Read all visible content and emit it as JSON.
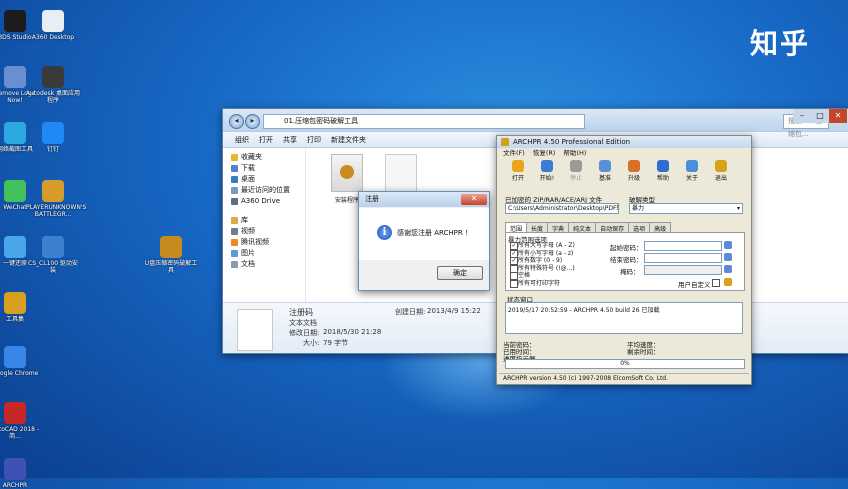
{
  "watermark": "知乎",
  "desktop_icons": [
    {
      "label": "3DS Studio",
      "color": "#1c1c1c"
    },
    {
      "label": "A360 Desktop",
      "color": "#e9eef5"
    },
    {
      "label": "Remove Logo Now!",
      "color": "#6a8fd0"
    },
    {
      "label": "Autodesk 桌面应用程序",
      "color": "#3a3a3a"
    },
    {
      "label": "网络截图工具",
      "color": "#2da8e0"
    },
    {
      "label": "钉钉",
      "color": "#1f8af5"
    },
    {
      "label": "WeChat",
      "color": "#43c15b"
    },
    {
      "label": "PLAYERUNKNOWN'S BATTLEGR...",
      "color": "#d69b2a"
    },
    {
      "label": "一键还原",
      "color": "#49a6e9"
    },
    {
      "label": "CS_CL100 驱动安装",
      "color": "#3d7fd1"
    },
    {
      "label": "U盘压缩密码破解工具",
      "color": "#c78a1e"
    },
    {
      "label": "工具集",
      "color": "#d7a020"
    },
    {
      "label": "Google Chrome",
      "color": "#3a86e8"
    },
    {
      "label": "AutoCAD 2018 - 简...",
      "color": "#c62828"
    },
    {
      "label": "ARCHPR",
      "color": "#3f51b5"
    }
  ],
  "explorer": {
    "address": "01.压缩包密码破解工具",
    "search_placeholder": "搜索 01.压缩包...",
    "toolbar": [
      "组织",
      "打开",
      "共享",
      "打印",
      "新建文件夹"
    ],
    "nav": {
      "favorites": "收藏夹",
      "favorites_items": [
        "下载",
        "桌面",
        "最近访问的位置",
        "A360 Drive"
      ],
      "library": "库",
      "library_items": [
        "视频",
        "腾讯视频",
        "图片",
        "文档"
      ]
    },
    "files": [
      {
        "name": "安装程序"
      },
      {
        "name": ""
      }
    ],
    "details": {
      "filename": "注册码",
      "type": "文本文档",
      "created_label": "创建日期:",
      "created": "2013/4/9 15:22",
      "modified_label": "修改日期:",
      "modified": "2018/5/30 21:28",
      "size_label": "大小:",
      "size": "79 字节"
    }
  },
  "dialog": {
    "title": "注册",
    "message": "感谢您注册 ARCHPR ！",
    "ok": "确定"
  },
  "archpr": {
    "title": "ARCHPR 4.50 Professional Edition",
    "menu": [
      "文件(F)",
      "恢复(R)",
      "帮助(H)"
    ],
    "toolbar": [
      {
        "label": "打开",
        "color": "#e7a51c",
        "enabled": true
      },
      {
        "label": "开始!",
        "color": "#3b7bd4",
        "enabled": true
      },
      {
        "label": "停止",
        "color": "#9a9a9a",
        "enabled": false
      },
      {
        "label": "基准",
        "color": "#5b8fd8",
        "enabled": true
      },
      {
        "label": "升级",
        "color": "#d86e2a",
        "enabled": true
      },
      {
        "label": "帮助",
        "color": "#2f6ed1",
        "enabled": true
      },
      {
        "label": "关于",
        "color": "#4a90d9",
        "enabled": true
      },
      {
        "label": "退出",
        "color": "#d5a21c",
        "enabled": true
      }
    ],
    "encrypted_file_label": "已加密的 ZIP/RAR/ACE/ARJ 文件",
    "encrypted_file_value": "C:\\Users\\Administrator\\Desktop\\PDF转换",
    "attack_type_label": "破解类型",
    "attack_type_value": "暴力",
    "tabs": [
      "范围",
      "长度",
      "字典",
      "纯文本",
      "自动保存",
      "选项",
      "高级"
    ],
    "range_section": "暴力范围选项",
    "checks": [
      {
        "label": "所有大写字母 (A - Z)",
        "checked": true
      },
      {
        "label": "所有小写字母 (a - z)",
        "checked": true
      },
      {
        "label": "所有数字 (0 - 9)",
        "checked": true
      },
      {
        "label": "所有特殊符号 (!@...)",
        "checked": false
      },
      {
        "label": "空格",
        "checked": false
      },
      {
        "label": "所有可打印字符",
        "checked": false
      }
    ],
    "start_pwd_label": "起始密码：",
    "end_pwd_label": "结束密码：",
    "mask_label": "掩码：",
    "custom_label": "用户自定义",
    "status_section": "状态窗口",
    "log": "2019/5/17 20:52:59 - ARCHPR 4.50 build 26 已加载",
    "current_pwd_label": "当前密码：",
    "elapsed_label": "已用时间：",
    "progress_label": "进度指示器",
    "avg_speed_label": "平均速度：",
    "remaining_label": "剩余时间：",
    "progress_value": "0%",
    "footer": "ARCHPR version 4.50 (c) 1997-2008 ElcomSoft Co. Ltd."
  }
}
